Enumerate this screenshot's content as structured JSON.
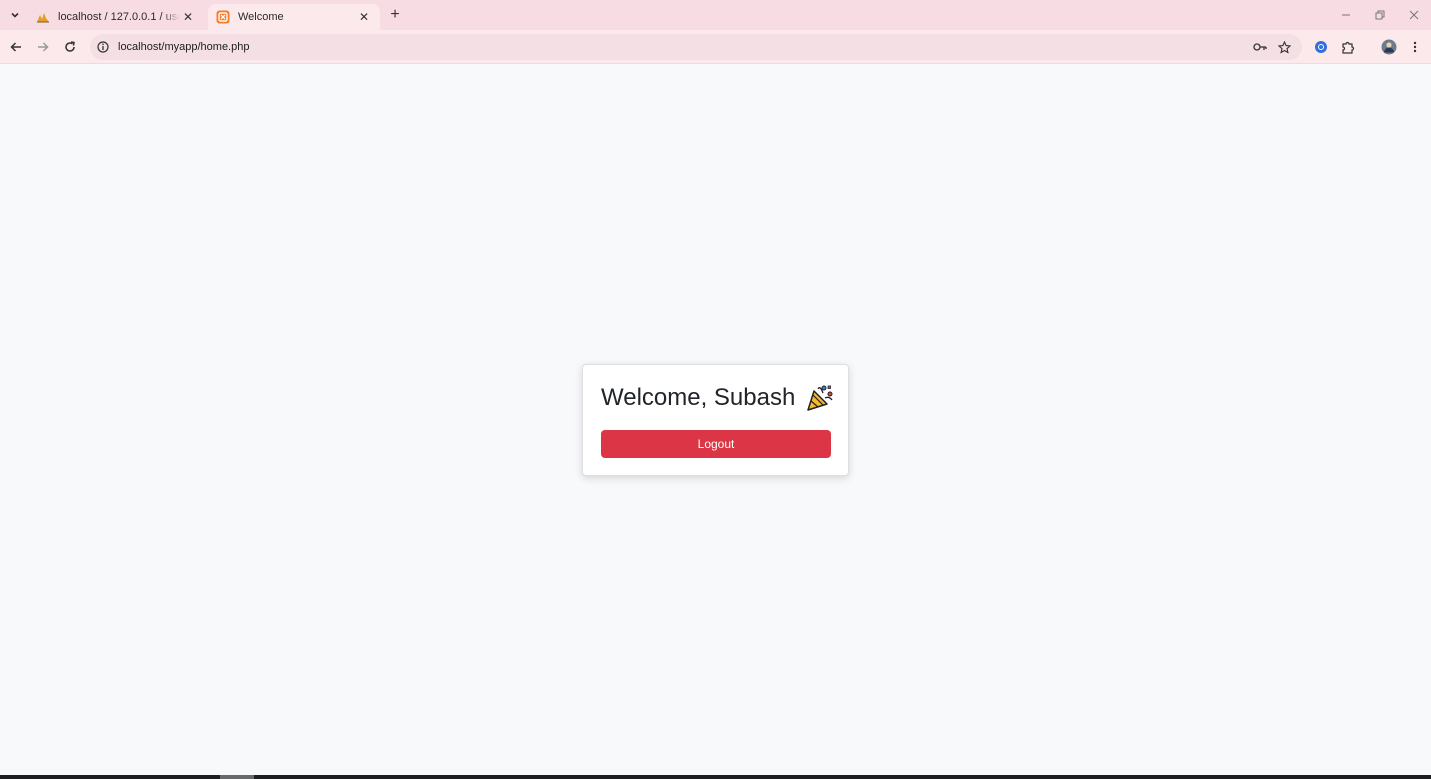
{
  "browser": {
    "tabs": [
      {
        "title": "localhost / 127.0.0.1 / user_db / ...",
        "active": false,
        "favicon": "phpmyadmin-icon"
      },
      {
        "title": "Welcome",
        "active": true,
        "favicon": "xampp-icon"
      }
    ],
    "address_bar": {
      "url": "localhost/myapp/home.php"
    }
  },
  "page": {
    "heading": "Welcome, Subash",
    "heading_icon": "party-popper-icon",
    "logout_label": "Logout",
    "colors": {
      "background": "#f8f9fa",
      "card": "#ffffff",
      "logout_button": "#dc3545",
      "heading_text": "#212529"
    }
  }
}
